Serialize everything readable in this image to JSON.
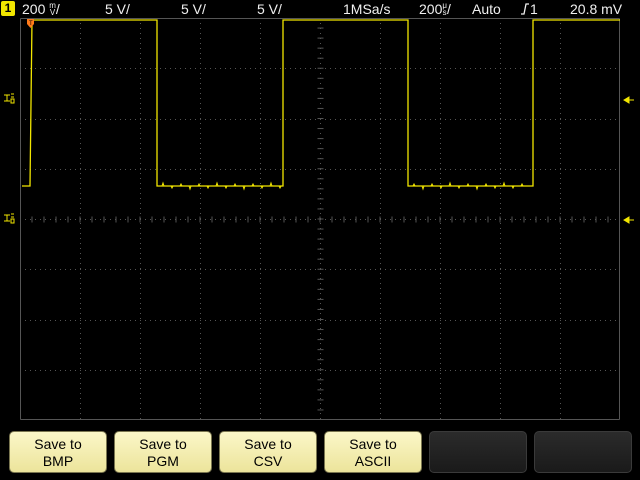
{
  "status": {
    "channel_number": "1",
    "ch1_scale_value": "200",
    "ch1_scale_unit_top": "m",
    "ch1_scale_unit_bottom": "V",
    "ch2_scale": "5 V",
    "ch3_scale": "5 V",
    "ch4_scale": "5 V",
    "sample_rate": "1MSa/s",
    "timebase_value": "200",
    "timebase_unit_top": "μ",
    "timebase_unit_bottom": "s",
    "trigger_mode": "Auto",
    "trigger_source": "1",
    "trigger_level": "20.8 mV"
  },
  "markers": {
    "trigger_position_icon": "orange-trigger-marker",
    "ground_marker_ch1": "ground-ref-icon",
    "ground_marker_ch2": "ground-ref-icon",
    "level_arrow": "left-arrow-icon"
  },
  "softkeys": [
    {
      "line1": "Save to",
      "line2": "BMP"
    },
    {
      "line1": "Save to",
      "line2": "PGM"
    },
    {
      "line1": "Save to",
      "line2": "CSV"
    },
    {
      "line1": "Save to",
      "line2": "ASCII"
    }
  ],
  "colors": {
    "trace": "#f2e600",
    "grid": "#555555",
    "trigger_marker": "#ff7a1a",
    "background": "#000000"
  }
}
